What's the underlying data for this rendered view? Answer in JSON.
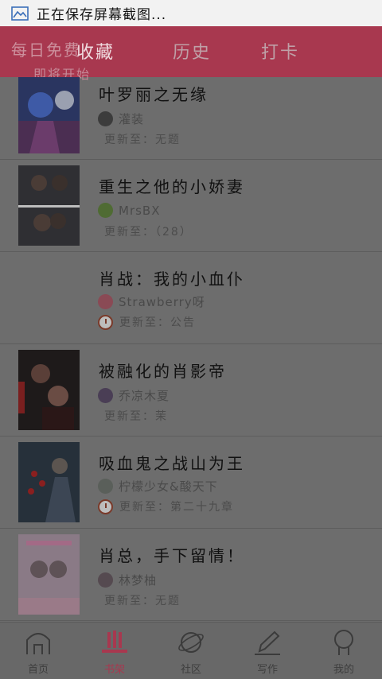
{
  "status_bar": {
    "text": "正在保存屏幕截图..."
  },
  "tabs": {
    "daily": "每日免费",
    "coming": "即将开始",
    "favorites": "收藏",
    "history": "历史",
    "checkin": "打卡"
  },
  "books": [
    {
      "title": "叶罗丽之无缘",
      "author": "灌装",
      "update": "更新至：无题",
      "has_clock": false
    },
    {
      "title": "重生之他的小娇妻",
      "author": "MrsBX",
      "update": "更新至：（28）",
      "has_clock": false
    },
    {
      "title": "肖战：我的小血仆",
      "author": "Strawberry呀",
      "update": "更新至：公告",
      "has_clock": true
    },
    {
      "title": "被融化的肖影帝",
      "author": "乔凉木夏",
      "update": "更新至：茉",
      "has_clock": false
    },
    {
      "title": "吸血鬼之战山为王",
      "author": "柠檬少女&酸天下",
      "update": "更新至：第二十九章",
      "has_clock": true
    },
    {
      "title": "肖总，手下留情！",
      "author": "林梦柚",
      "update": "更新至：无题",
      "has_clock": false
    }
  ],
  "bottom_nav": [
    {
      "label": "首页",
      "icon": "home-icon",
      "active": false
    },
    {
      "label": "书架",
      "icon": "bookshelf-icon",
      "active": true
    },
    {
      "label": "社区",
      "icon": "community-planet-icon",
      "active": false
    },
    {
      "label": "写作",
      "icon": "pen-icon",
      "active": false
    },
    {
      "label": "我的",
      "icon": "profile-icon",
      "active": false
    }
  ],
  "colors": {
    "accent": "#a8384f",
    "dim_overlay": "#6d6d6d"
  }
}
